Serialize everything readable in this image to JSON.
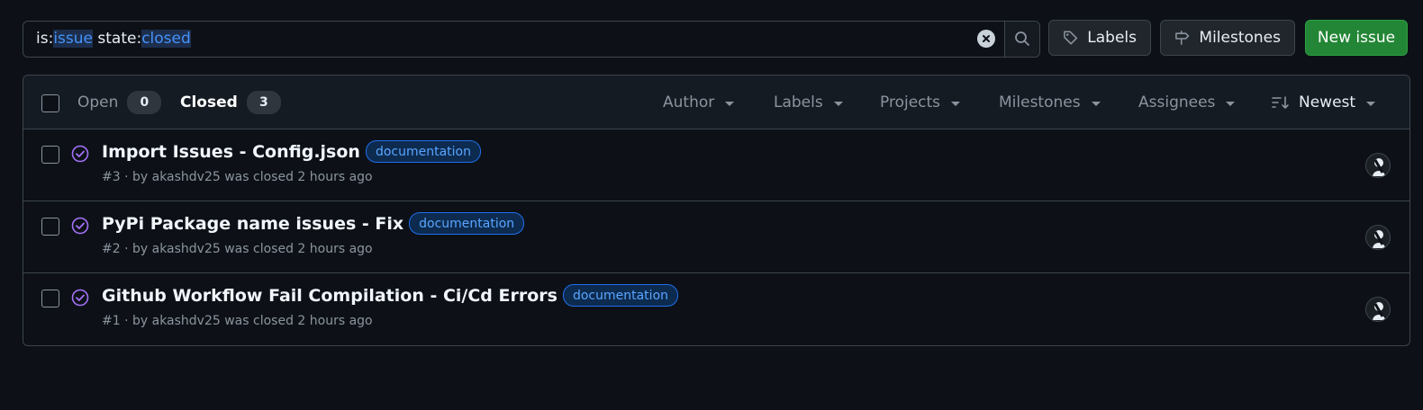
{
  "search": {
    "query_parts": [
      {
        "text": "is:",
        "kind": "kw"
      },
      {
        "text": "issue",
        "kind": "val"
      },
      {
        "text": " state:",
        "kind": "kw"
      },
      {
        "text": "closed",
        "kind": "val"
      }
    ],
    "clear_icon": "x-circle-fill-icon",
    "search_icon": "search-icon"
  },
  "toolbar": {
    "labels_label": "Labels",
    "labels_icon": "tag-icon",
    "milestones_label": "Milestones",
    "milestones_icon": "milestone-icon",
    "new_issue_label": "New issue"
  },
  "header": {
    "open_label": "Open",
    "open_count": "0",
    "closed_label": "Closed",
    "closed_count": "3",
    "filters": [
      "Author",
      "Labels",
      "Projects",
      "Milestones",
      "Assignees"
    ],
    "sort_label": "Newest",
    "sort_icon": "sort-desc-icon"
  },
  "issues": [
    {
      "title": "Import Issues - Config.json",
      "label": "documentation",
      "meta": "#3 · by akashdv25 was closed 2 hours ago",
      "status_icon": "issue-closed-icon"
    },
    {
      "title": "PyPi Package name issues - Fix",
      "label": "documentation",
      "meta": "#2 · by akashdv25 was closed 2 hours ago",
      "status_icon": "issue-closed-icon"
    },
    {
      "title": "Github Workflow Fail Compilation - Ci/Cd Errors",
      "label": "documentation",
      "meta": "#1 · by akashdv25 was closed 2 hours ago",
      "status_icon": "issue-closed-icon"
    }
  ],
  "colors": {
    "background": "#0d1117",
    "closed_purple": "#a371f7",
    "label_blue": "#58a6ff",
    "primary_green": "#238636"
  }
}
